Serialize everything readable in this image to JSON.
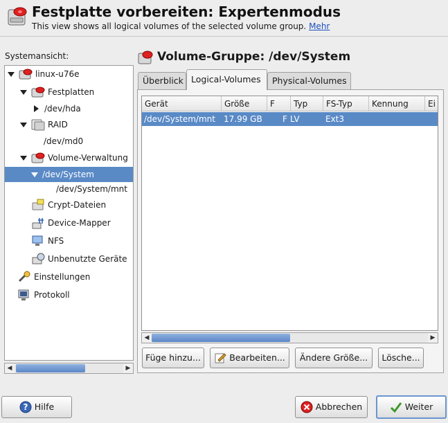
{
  "header": {
    "title": "Festplatte vorbereiten: Expertenmodus",
    "subtitle": "This view shows all logical volumes of the selected volume group.",
    "more_link": "Mehr",
    "icon": "disk-icon"
  },
  "left": {
    "label": "Systemansicht:",
    "tree": [
      {
        "label": "linux-u76e",
        "icon": "disk-red-icon",
        "expand": "open"
      },
      {
        "label": "Festplatten",
        "icon": "disk-red-icon",
        "expand": "open"
      },
      {
        "label": "/dev/hda",
        "icon": "",
        "expand": "closed"
      },
      {
        "label": "RAID",
        "icon": "raid-icon",
        "expand": "open"
      },
      {
        "label": "/dev/md0",
        "icon": "",
        "expand": "none"
      },
      {
        "label": "Volume-Verwaltung",
        "icon": "disk-red-icon",
        "expand": "open"
      },
      {
        "label": "/dev/System",
        "icon": "",
        "expand": "open",
        "selected": true
      },
      {
        "label": "/dev/System/mnt",
        "icon": "",
        "expand": "none"
      },
      {
        "label": "Crypt-Dateien",
        "icon": "crypt-icon",
        "expand": "none"
      },
      {
        "label": "Device-Mapper",
        "icon": "device-mapper-icon",
        "expand": "none"
      },
      {
        "label": "NFS",
        "icon": "nfs-icon",
        "expand": "none"
      },
      {
        "label": "Unbenutzte Geräte",
        "icon": "unused-devices-icon",
        "expand": "none"
      },
      {
        "label": "Einstellungen",
        "icon": "settings-icon",
        "expand": "none"
      },
      {
        "label": "Protokoll",
        "icon": "log-icon",
        "expand": "none"
      }
    ]
  },
  "right": {
    "title": "Volume-Gruppe: /dev/System",
    "tabs": [
      "Überblick",
      "Logical-Volumes",
      "Physical-Volumes"
    ],
    "active_tab": "Logical-Volumes",
    "columns": [
      "Gerät",
      "Größe",
      "F",
      "Typ",
      "FS-Typ",
      "Kennung",
      "Ei"
    ],
    "rows": [
      [
        "/dev/System/mnt",
        "17.99 GB",
        "F",
        "LV",
        "Ext3",
        "",
        ""
      ]
    ],
    "buttons": {
      "add": "Füge hinzu...",
      "edit": "Bearbeiten...",
      "resize": "Ändere Größe...",
      "delete": "Lösche..."
    }
  },
  "footer": {
    "help": "Hilfe",
    "cancel": "Abbrechen",
    "next": "Weiter"
  },
  "colors": {
    "selection": "#5a8ac6",
    "background": "#ededed"
  }
}
